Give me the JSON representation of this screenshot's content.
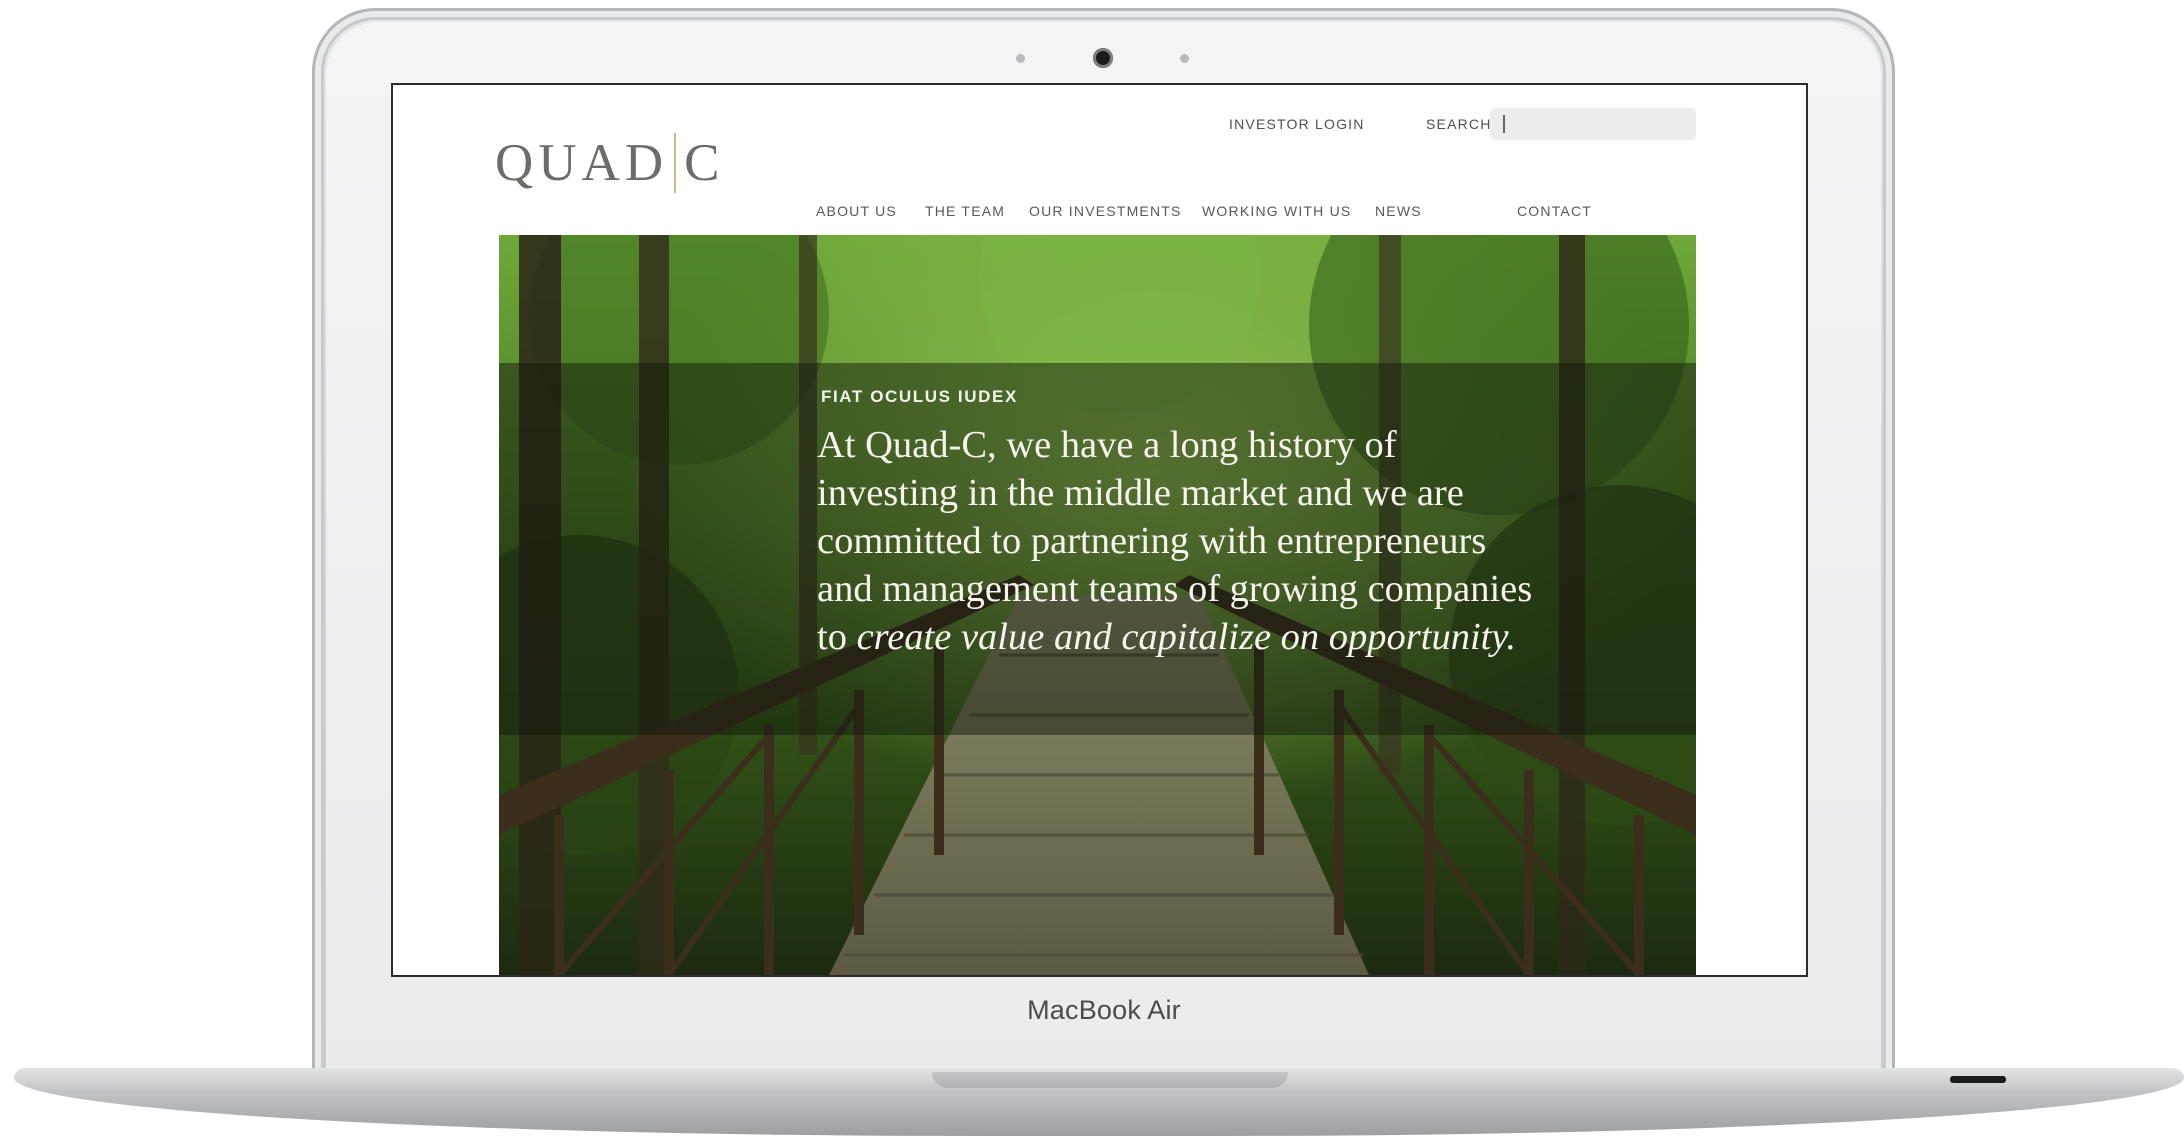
{
  "device": {
    "brand_label": "MacBook Air"
  },
  "site": {
    "logo": {
      "left": "QUAD",
      "right": "C"
    },
    "header": {
      "investor_login": "INVESTOR LOGIN",
      "search_label": "SEARCH",
      "search_value": ""
    },
    "nav": [
      {
        "label": "ABOUT US"
      },
      {
        "label": "THE TEAM"
      },
      {
        "label": "OUR INVESTMENTS"
      },
      {
        "label": "WORKING WITH US"
      },
      {
        "label": "NEWS"
      },
      {
        "label": "CONTACT"
      }
    ],
    "hero": {
      "eyebrow": "FIAT OCULUS IUDEX",
      "quote_plain": "At Quad-C, we have a long history of investing in the middle market and we are committed to partnering with entrepreneurs and management teams of growing companies to ",
      "quote_italic": "create value and capitalize on opportunity.",
      "image": "forest footbridge photo"
    }
  },
  "colors": {
    "logo_divider": "#c9b98a",
    "nav_text": "#585858",
    "hero_text": "#f6f4ec"
  }
}
